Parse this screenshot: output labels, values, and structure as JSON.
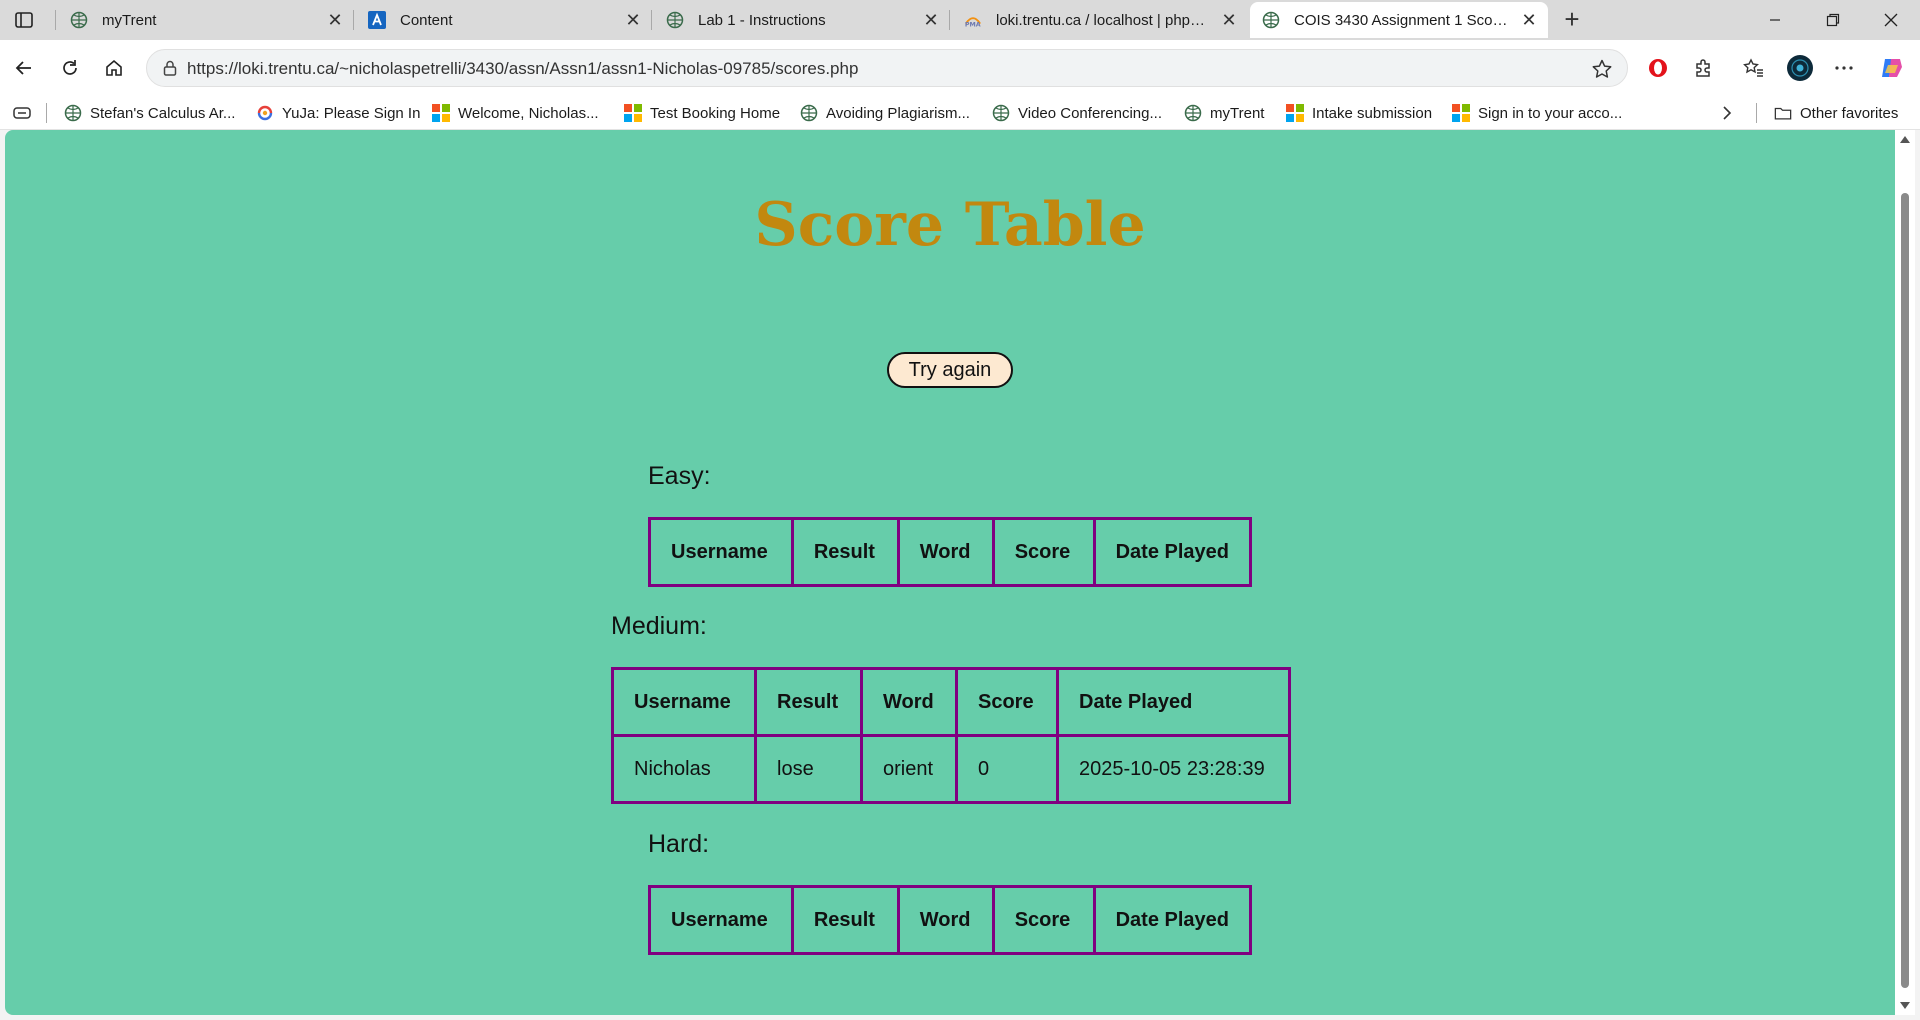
{
  "browser": {
    "tabs": [
      {
        "label": "myTrent",
        "icon": "trent-globe-icon"
      },
      {
        "label": "Content",
        "icon": "d2l-logo-icon"
      },
      {
        "label": "Lab 1 - Instructions",
        "icon": "trent-globe-icon"
      },
      {
        "label": "loki.trentu.ca / localhost | phpMyAdmin",
        "icon": "phpmyadmin-icon"
      },
      {
        "label": "COIS 3430 Assignment 1 Scores",
        "icon": "trent-globe-icon",
        "active": true
      }
    ],
    "url": "https://loki.trentu.ca/~nicholaspetrelli/3430/assn/Assn1/assn1-Nicholas-09785/scores.php",
    "favorites": [
      {
        "label": "Stefan's Calculus Ar...",
        "icon": "trent-globe-icon"
      },
      {
        "label": "YuJa: Please Sign In",
        "icon": "yuja-icon"
      },
      {
        "label": "Welcome, Nicholas...",
        "icon": "microsoft-icon"
      },
      {
        "label": "Test Booking Home",
        "icon": "microsoft-icon"
      },
      {
        "label": "Avoiding Plagiarism...",
        "icon": "trent-globe-icon"
      },
      {
        "label": "Video Conferencing...",
        "icon": "trent-globe-icon"
      },
      {
        "label": "myTrent",
        "icon": "trent-globe-icon"
      },
      {
        "label": "Intake submission",
        "icon": "microsoft-icon"
      },
      {
        "label": "Sign in to your acco...",
        "icon": "microsoft-icon"
      }
    ],
    "other_favorites": "Other favorites"
  },
  "page": {
    "title": "Score Table",
    "try_again": "Try again",
    "columns": [
      "Username",
      "Result",
      "Word",
      "Score",
      "Date Played"
    ],
    "sections": [
      {
        "label": "Easy:",
        "rows": []
      },
      {
        "label": "Medium:",
        "rows": [
          {
            "username": "Nicholas",
            "result": "lose",
            "word": "orient",
            "score": "0",
            "date_played": "2025-10-05 23:28:39"
          }
        ]
      },
      {
        "label": "Hard:",
        "rows": []
      }
    ]
  },
  "colors": {
    "page_background": "#66cdaa",
    "title": "#c2880f",
    "table_border": "#800080",
    "button_background": "#fde9d1"
  }
}
